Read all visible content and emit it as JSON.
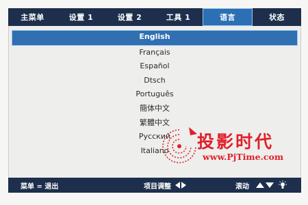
{
  "tabs": [
    {
      "label": "主菜单",
      "active": false
    },
    {
      "label": "设置 1",
      "active": false
    },
    {
      "label": "设置 2",
      "active": false
    },
    {
      "label": "工具 1",
      "active": false
    },
    {
      "label": "语言",
      "active": true
    },
    {
      "label": "状态",
      "active": false
    }
  ],
  "languages": [
    {
      "label": "English",
      "selected": true
    },
    {
      "label": "Français",
      "selected": false
    },
    {
      "label": "Español",
      "selected": false
    },
    {
      "label": "Dtsch",
      "selected": false
    },
    {
      "label": "Português",
      "selected": false
    },
    {
      "label": "簡体中文",
      "selected": false
    },
    {
      "label": "繁體中文",
      "selected": false
    },
    {
      "label": "Русский",
      "selected": false
    },
    {
      "label": "Italiano",
      "selected": false
    }
  ],
  "help": {
    "exit": "菜单 = 退出",
    "adjust": "项目调整",
    "scroll": "滚动"
  },
  "watermark": {
    "title": "投影时代",
    "url": "www.PjTime.com"
  },
  "colors": {
    "bar": "#1d2f4c",
    "highlight": "#2f6fb2",
    "watermark": "#e0202a"
  }
}
